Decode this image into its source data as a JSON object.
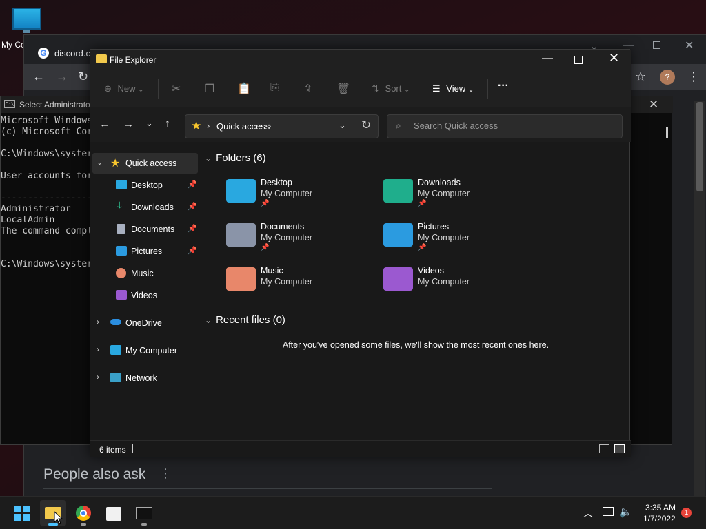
{
  "desktop": {
    "icon_label": "My Co"
  },
  "chrome": {
    "tab_title": "discord.co",
    "people_also_ask": "People also ask",
    "kebab": "⋮"
  },
  "cmd": {
    "title": "Select Administrator",
    "lines": "Microsoft Windows\n(c) Microsoft Cor\n\nC:\\Windows\\syster\n\nUser accounts for\n\n------------------\nAdministrator\nLocalAdmin\nThe command compl\n\n\nC:\\Windows\\syster"
  },
  "explorer": {
    "title": "File Explorer",
    "commands": {
      "new": "New",
      "sort": "Sort",
      "view": "View",
      "more": "···"
    },
    "address": {
      "location": "Quick access"
    },
    "search": {
      "placeholder": "Search Quick access"
    },
    "sidebar": {
      "quick_access": "Quick access",
      "pinned": [
        {
          "label": "Desktop",
          "icon": "desktop-folder-icon"
        },
        {
          "label": "Downloads",
          "icon": "downloads-icon"
        },
        {
          "label": "Documents",
          "icon": "documents-icon"
        },
        {
          "label": "Pictures",
          "icon": "pictures-icon"
        }
      ],
      "unpinned": [
        {
          "label": "Music",
          "icon": "music-icon"
        },
        {
          "label": "Videos",
          "icon": "videos-icon"
        }
      ],
      "onedrive": "OneDrive",
      "my_computer": "My Computer",
      "network": "Network"
    },
    "folders_header": "Folders (6)",
    "folders": [
      {
        "name": "Desktop",
        "location": "My Computer",
        "pinned": true,
        "color": "#29a8e0"
      },
      {
        "name": "Downloads",
        "location": "My Computer",
        "pinned": true,
        "color": "#1fae8c"
      },
      {
        "name": "Documents",
        "location": "My Computer",
        "pinned": true,
        "color": "#8a94a8"
      },
      {
        "name": "Pictures",
        "location": "My Computer",
        "pinned": true,
        "color": "#2b9be0"
      },
      {
        "name": "Music",
        "location": "My Computer",
        "pinned": false,
        "color": "#e8876a"
      },
      {
        "name": "Videos",
        "location": "My Computer",
        "pinned": false,
        "color": "#9b59d0"
      }
    ],
    "recent_header": "Recent files (0)",
    "recent_empty": "After you've opened some files, we'll show the most recent ones here.",
    "status": {
      "count": "6 items"
    }
  },
  "taskbar": {
    "time": "3:35 AM",
    "date": "1/7/2022",
    "notification_count": "1"
  }
}
